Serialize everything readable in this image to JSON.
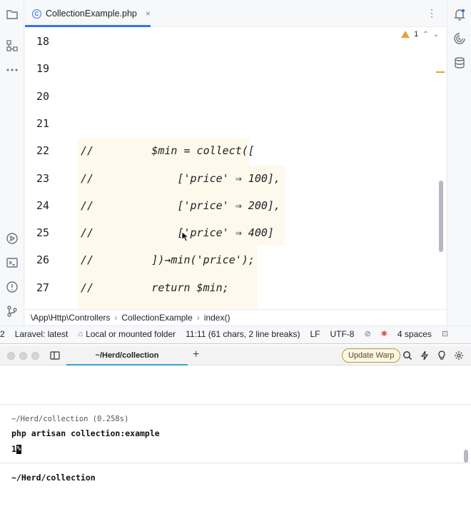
{
  "ide": {
    "tab": {
      "file_name": "CollectionExample.php",
      "close_glyph": "×",
      "menu_glyph": "⋮"
    },
    "inspection": {
      "warning_count": "1"
    },
    "line_numbers": [
      "18",
      "19",
      "20",
      "21",
      "22",
      "23",
      "24",
      "25",
      "26",
      "27"
    ],
    "code_lines": [
      "",
      "",
      "",
      "",
      "//         $min = collect([",
      "//             ['price' ⇒ 100],",
      "//             ['price' ⇒ 200],",
      "//             ['price' ⇒ 400]",
      "//         ])→min('price');",
      "//         return $min;"
    ],
    "breadcrumbs": [
      "\\App\\Http\\Controllers",
      "CollectionExample",
      "index()"
    ],
    "breadcrumb_sep": "›",
    "status_bar": {
      "left_fragment": "2",
      "laravel": "Laravel: latest",
      "folder": "Local or mounted folder",
      "position": "11:11 (61 chars, 2 line breaks)",
      "line_sep": "LF",
      "encoding": "UTF-8",
      "indent": "4 spaces"
    },
    "left_rail_icons": [
      "folder-icon",
      "structure-icon",
      "more-icon",
      "run-icon",
      "terminal-icon",
      "problems-icon",
      "git-icon"
    ],
    "right_rail_icons": [
      "notifications-icon",
      "ai-assistant-icon",
      "database-icon"
    ]
  },
  "terminal": {
    "tab_title": "~/Herd/collection",
    "new_tab_glyph": "+",
    "update_button": "Update Warp",
    "block": {
      "meta": "~/Herd/collection (0.258s)",
      "command": "php artisan collection:example",
      "output": "1",
      "output_cursor": "%"
    },
    "prompt": "~/Herd/collection"
  },
  "colors": {
    "accent": "#3574f0",
    "highlight_block": "#fdf9ec",
    "warning": "#e6a23c",
    "warp_tab_underline": "#3aa0d8"
  }
}
